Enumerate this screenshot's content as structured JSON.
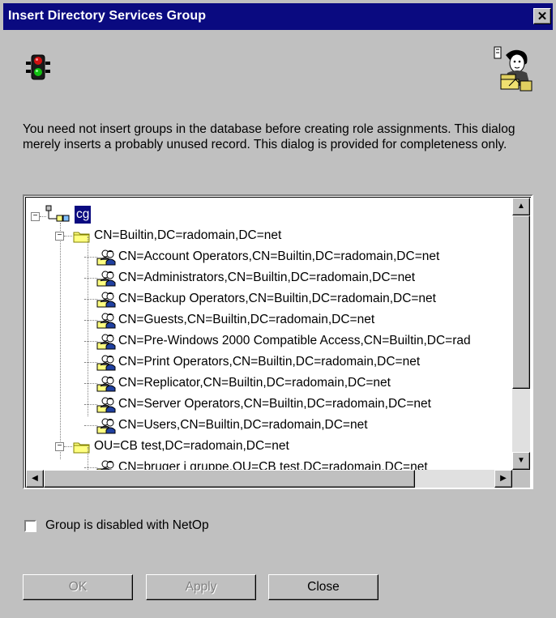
{
  "window": {
    "title": "Insert Directory Services Group",
    "close_glyph": "✕"
  },
  "icons": {
    "left": "traffic-light-icon",
    "right": "directory-people-icon"
  },
  "description": "You need not insert groups in the database before creating role assignments. This dialog merely inserts a probably unused record. This dialog is provided for completeness only.",
  "tree": {
    "root": "cg",
    "nodes": [
      {
        "level": 1,
        "type": "folder",
        "expander": "−",
        "label": "CN=Builtin,DC=radomain,DC=net"
      },
      {
        "level": 2,
        "type": "group",
        "label": "CN=Account Operators,CN=Builtin,DC=radomain,DC=net"
      },
      {
        "level": 2,
        "type": "group",
        "label": "CN=Administrators,CN=Builtin,DC=radomain,DC=net"
      },
      {
        "level": 2,
        "type": "group",
        "label": "CN=Backup Operators,CN=Builtin,DC=radomain,DC=net"
      },
      {
        "level": 2,
        "type": "group",
        "label": "CN=Guests,CN=Builtin,DC=radomain,DC=net"
      },
      {
        "level": 2,
        "type": "group",
        "label": "CN=Pre-Windows 2000 Compatible Access,CN=Builtin,DC=rad"
      },
      {
        "level": 2,
        "type": "group",
        "label": "CN=Print Operators,CN=Builtin,DC=radomain,DC=net"
      },
      {
        "level": 2,
        "type": "group",
        "label": "CN=Replicator,CN=Builtin,DC=radomain,DC=net"
      },
      {
        "level": 2,
        "type": "group",
        "label": "CN=Server Operators,CN=Builtin,DC=radomain,DC=net"
      },
      {
        "level": 2,
        "type": "group",
        "label": "CN=Users,CN=Builtin,DC=radomain,DC=net"
      },
      {
        "level": 1,
        "type": "folder",
        "expander": "−",
        "label": "OU=CB test,DC=radomain,DC=net"
      },
      {
        "level": 2,
        "type": "group",
        "label": "CN=bruger i gruppe,OU=CB test,DC=radomain,DC=net"
      }
    ]
  },
  "checkbox": {
    "label": "Group is disabled with NetOp",
    "checked": false
  },
  "buttons": {
    "ok": "OK",
    "apply": "Apply",
    "close": "Close"
  },
  "scroll": {
    "up": "▲",
    "down": "▼",
    "left": "◀",
    "right": "▶"
  },
  "colors": {
    "titlebar": "#0a0a80",
    "selection": "#0a0a80",
    "face": "#c0c0c0"
  }
}
